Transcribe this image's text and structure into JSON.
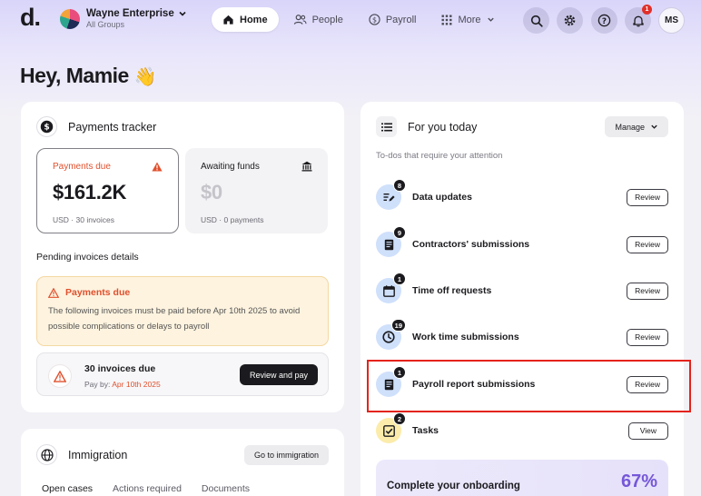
{
  "header": {
    "logo": "d.",
    "org_name": "Wayne Enterprise",
    "org_sub": "All Groups",
    "nav": [
      {
        "label": "Home",
        "icon": "home-icon"
      },
      {
        "label": "People",
        "icon": "people-icon"
      },
      {
        "label": "Payroll",
        "icon": "dollar-icon"
      },
      {
        "label": "More",
        "icon": "grid-icon"
      }
    ],
    "notification_count": "1",
    "user_initials": "MS"
  },
  "greeting": "Hey, Mamie",
  "greeting_emoji": "👋",
  "payments_tracker": {
    "title": "Payments tracker",
    "due": {
      "label": "Payments due",
      "amount": "$161.2K",
      "meta": "USD · 30 invoices"
    },
    "awaiting": {
      "label": "Awaiting funds",
      "amount": "$0",
      "meta": "USD · 0 payments"
    },
    "pending_title": "Pending invoices details",
    "alert": {
      "title": "Payments due",
      "text": "The following invoices must be paid before Apr 10th 2025 to avoid possible complications or delays to payroll"
    },
    "due_row": {
      "title": "30 invoices due",
      "pay_by": "Pay by:",
      "date": "Apr 10th 2025",
      "button": "Review and pay"
    },
    "colors": {
      "warning": "#e0502d",
      "alert_bg": "#fdf3df"
    }
  },
  "immigration": {
    "title": "Immigration",
    "button": "Go to immigration",
    "tabs": [
      "Open cases",
      "Actions required",
      "Documents"
    ]
  },
  "for_you": {
    "title": "For you today",
    "manage": "Manage",
    "subtitle": "To-dos that require your attention",
    "items": [
      {
        "label": "Data updates",
        "count": "8",
        "button": "Review",
        "icon": "edit-list-icon"
      },
      {
        "label": "Contractors' submissions",
        "count": "9",
        "button": "Review",
        "icon": "document-icon"
      },
      {
        "label": "Time off requests",
        "count": "1",
        "button": "Review",
        "icon": "calendar-icon"
      },
      {
        "label": "Work time submissions",
        "count": "19",
        "button": "Review",
        "icon": "clock-icon"
      },
      {
        "label": "Payroll report submissions",
        "count": "1",
        "button": "Review",
        "icon": "document-icon"
      },
      {
        "label": "Tasks",
        "count": "2",
        "button": "View",
        "icon": "checkbox-icon"
      }
    ],
    "onboarding": {
      "title": "Complete your onboarding",
      "percent": "67%"
    },
    "highlight_color": "#e4231b"
  }
}
